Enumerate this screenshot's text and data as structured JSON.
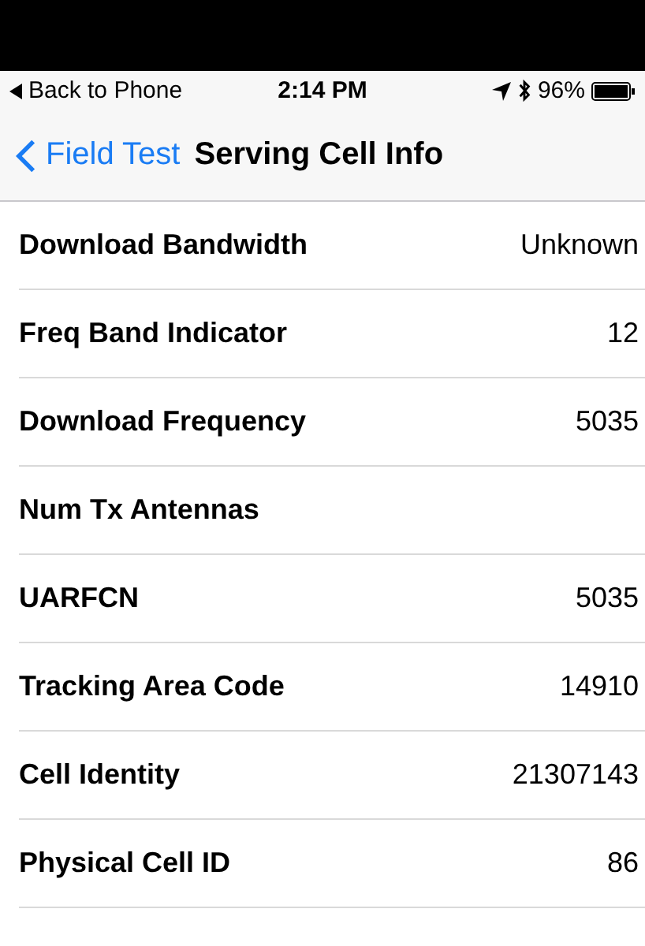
{
  "status_bar": {
    "back_label": "Back to Phone",
    "time": "2:14 PM",
    "battery": "96%"
  },
  "nav_bar": {
    "back": "Field Test",
    "title": "Serving Cell Info"
  },
  "rows": [
    {
      "label": "Download Bandwidth",
      "value": "Unknown"
    },
    {
      "label": "Freq Band Indicator",
      "value": "12"
    },
    {
      "label": "Download Frequency",
      "value": "5035"
    },
    {
      "label": "Num Tx Antennas"
    },
    {
      "label": "UARFCN",
      "value": "5035"
    },
    {
      "label": "Tracking Area Code",
      "value": "14910"
    },
    {
      "label": "Cell Identity",
      "value": "21307143"
    },
    {
      "label": "Physical Cell ID",
      "value": "86"
    }
  ]
}
